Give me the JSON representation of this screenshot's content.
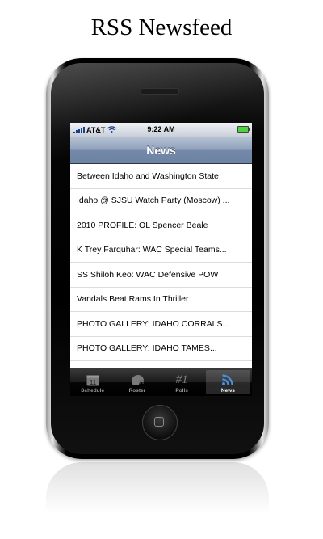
{
  "page_title": "RSS Newsfeed",
  "status_bar": {
    "carrier": "AT&T",
    "time": "9:22 AM"
  },
  "nav": {
    "title": "News"
  },
  "news_items": [
    "Between Idaho and Washington State",
    "Idaho @ SJSU Watch Party (Moscow) ...",
    "2010 PROFILE:  OL Spencer Beale",
    "K Trey Farquhar: WAC Special Teams...",
    "SS Shiloh Keo: WAC Defensive POW",
    "Vandals Beat Rams In Thriller",
    "PHOTO GALLERY: IDAHO CORRALS...",
    "PHOTO GALLERY: IDAHO TAMES..."
  ],
  "tabs": [
    {
      "label": "Schedule",
      "icon": "calendar-icon",
      "icon_text": "11",
      "active": false
    },
    {
      "label": "Roster",
      "icon": "helmet-icon",
      "active": false
    },
    {
      "label": "Polls",
      "icon": "ranking-icon",
      "icon_text": "#1",
      "active": false
    },
    {
      "label": "News",
      "icon": "rss-icon",
      "active": true
    }
  ],
  "colors": {
    "nav_bar": "#7f93b1",
    "tab_active_icon": "#4a90e2",
    "battery": "#4cd43d"
  }
}
